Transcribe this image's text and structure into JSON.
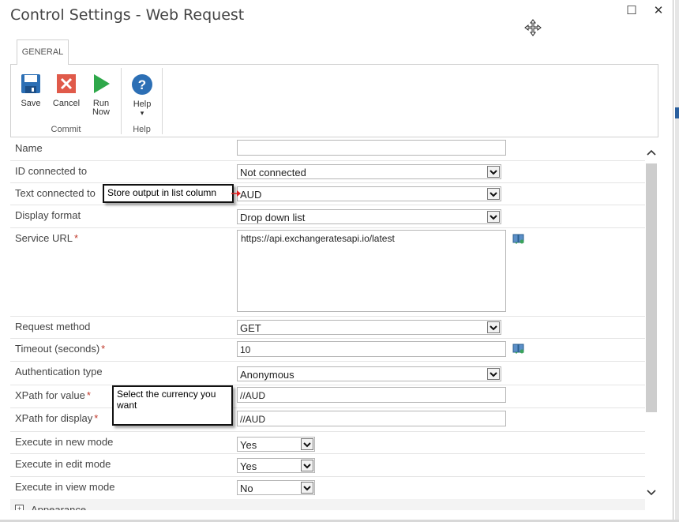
{
  "window": {
    "title": "Control Settings - Web Request",
    "maximize_glyph": "☐",
    "close_glyph": "✕"
  },
  "tabs": [
    {
      "label": "GENERAL"
    }
  ],
  "ribbon": {
    "groups": [
      {
        "label": "Commit",
        "buttons": [
          {
            "label": "Save",
            "icon": "save-icon"
          },
          {
            "label": "Cancel",
            "icon": "cancel-icon"
          },
          {
            "label_line1": "Run",
            "label_line2": "Now",
            "icon": "run-icon"
          }
        ]
      },
      {
        "label": "Help",
        "buttons": [
          {
            "label": "Help",
            "icon": "help-icon",
            "dropdown": "▾"
          }
        ]
      }
    ]
  },
  "form": {
    "name": {
      "label": "Name",
      "value": ""
    },
    "id_connected": {
      "label": "ID connected to",
      "value": "Not connected"
    },
    "text_connected": {
      "label": "Text connected to",
      "value": "AUD"
    },
    "display_format": {
      "label": "Display format",
      "value": "Drop down list"
    },
    "service_url": {
      "label": "Service URL",
      "required": "*",
      "value": "https://api.exchangeratesapi.io/latest"
    },
    "request_method": {
      "label": "Request method",
      "value": "GET"
    },
    "timeout": {
      "label": "Timeout (seconds)",
      "required": "*",
      "value": "10"
    },
    "auth_type": {
      "label": "Authentication type",
      "value": "Anonymous"
    },
    "xpath_value": {
      "label": "XPath for value",
      "required": "*",
      "value": "//AUD"
    },
    "xpath_display": {
      "label": "XPath for display",
      "required": "*",
      "value": "//AUD"
    },
    "exec_new": {
      "label": "Execute in new mode",
      "value": "Yes"
    },
    "exec_edit": {
      "label": "Execute in edit mode",
      "value": "Yes"
    },
    "exec_view": {
      "label": "Execute in view mode",
      "value": "No"
    }
  },
  "sections": {
    "appearance": {
      "label": "Appearance",
      "toggle": "+"
    }
  },
  "annotations": {
    "store_output": "Store output in list column",
    "select_currency": "Select the currency you want"
  },
  "colors": {
    "save_blue": "#2c6fb5",
    "cancel_red": "#e05a4a",
    "run_green": "#2ea84a",
    "help_blue": "#2c6fb5",
    "required_red": "#c0392b",
    "arrow_red": "#e02020"
  }
}
